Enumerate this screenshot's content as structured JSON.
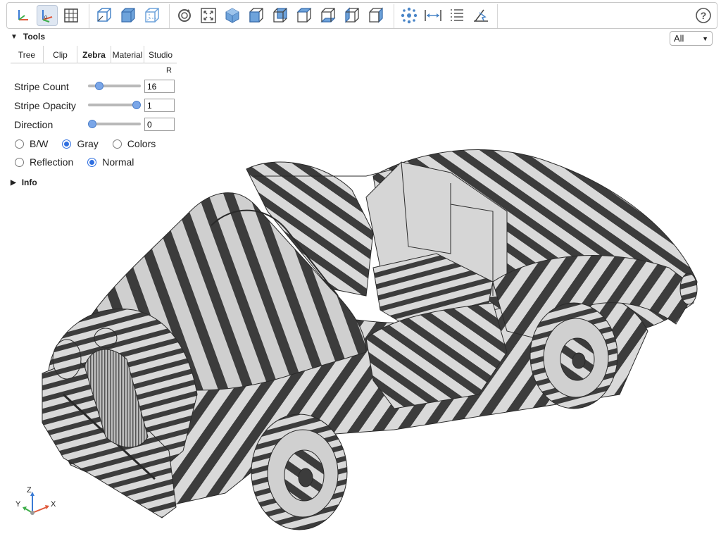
{
  "toolbar": {
    "buttons": [
      {
        "name": "axes-icon",
        "active": false
      },
      {
        "name": "axes-origin-icon",
        "active": true
      },
      {
        "name": "grid-icon",
        "active": false
      },
      {
        "name": "perspective-icon",
        "active": false
      },
      {
        "name": "solid-cube-icon",
        "active": false
      },
      {
        "name": "wireframe-cube-icon",
        "active": false
      },
      {
        "name": "reset-view-icon",
        "active": false
      },
      {
        "name": "fit-view-icon",
        "active": false
      },
      {
        "name": "iso-view-icon",
        "active": false
      },
      {
        "name": "front-view-icon",
        "active": false
      },
      {
        "name": "rear-view-icon",
        "active": false
      },
      {
        "name": "top-view-icon",
        "active": false
      },
      {
        "name": "bottom-view-icon",
        "active": false
      },
      {
        "name": "left-view-icon",
        "active": false
      },
      {
        "name": "right-view-icon",
        "active": false
      },
      {
        "name": "explode-icon",
        "active": false
      },
      {
        "name": "measure-distance-icon",
        "active": false
      },
      {
        "name": "properties-icon",
        "active": false
      },
      {
        "name": "measure-angle-icon",
        "active": false
      }
    ],
    "help_label": "?"
  },
  "tools": {
    "title": "Tools",
    "tabs": [
      "Tree",
      "Clip",
      "Zebra",
      "Material",
      "Studio"
    ],
    "active_tab": "Zebra",
    "r_label": "R",
    "stripe_count": {
      "label": "Stripe Count",
      "value": "16",
      "level": 0.16
    },
    "stripe_opacity": {
      "label": "Stripe Opacity",
      "value": "1",
      "level": 1.0
    },
    "direction": {
      "label": "Direction",
      "value": "0",
      "level": 0.0
    },
    "color_modes": [
      {
        "label": "B/W",
        "selected": false
      },
      {
        "label": "Gray",
        "selected": true
      },
      {
        "label": "Colors",
        "selected": false
      }
    ],
    "mapping_modes": [
      {
        "label": "Reflection",
        "selected": false
      },
      {
        "label": "Normal",
        "selected": true
      }
    ]
  },
  "info": {
    "title": "Info"
  },
  "filter_select": {
    "value": "All"
  },
  "triad": {
    "x": "X",
    "y": "Y",
    "z": "Z"
  },
  "colors": {
    "accent": "#2f6fe0",
    "stripe_dark": "#3c3c3c",
    "stripe_light": "#d9d9d9",
    "toolbar_icon": "#4a86c8"
  }
}
